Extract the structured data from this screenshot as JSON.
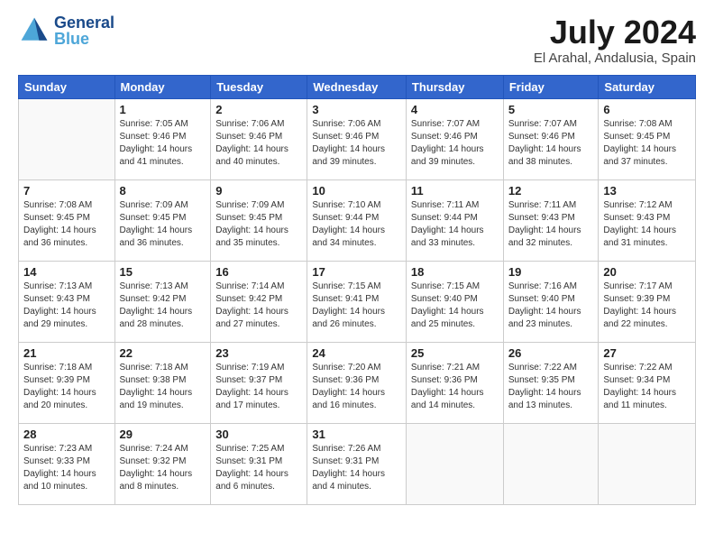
{
  "header": {
    "logo_general": "General",
    "logo_blue": "Blue",
    "month_year": "July 2024",
    "location": "El Arahal, Andalusia, Spain"
  },
  "days_of_week": [
    "Sunday",
    "Monday",
    "Tuesday",
    "Wednesday",
    "Thursday",
    "Friday",
    "Saturday"
  ],
  "weeks": [
    [
      {
        "day": "",
        "sunrise": "",
        "sunset": "",
        "daylight": ""
      },
      {
        "day": "1",
        "sunrise": "Sunrise: 7:05 AM",
        "sunset": "Sunset: 9:46 PM",
        "daylight": "Daylight: 14 hours and 41 minutes."
      },
      {
        "day": "2",
        "sunrise": "Sunrise: 7:06 AM",
        "sunset": "Sunset: 9:46 PM",
        "daylight": "Daylight: 14 hours and 40 minutes."
      },
      {
        "day": "3",
        "sunrise": "Sunrise: 7:06 AM",
        "sunset": "Sunset: 9:46 PM",
        "daylight": "Daylight: 14 hours and 39 minutes."
      },
      {
        "day": "4",
        "sunrise": "Sunrise: 7:07 AM",
        "sunset": "Sunset: 9:46 PM",
        "daylight": "Daylight: 14 hours and 39 minutes."
      },
      {
        "day": "5",
        "sunrise": "Sunrise: 7:07 AM",
        "sunset": "Sunset: 9:46 PM",
        "daylight": "Daylight: 14 hours and 38 minutes."
      },
      {
        "day": "6",
        "sunrise": "Sunrise: 7:08 AM",
        "sunset": "Sunset: 9:45 PM",
        "daylight": "Daylight: 14 hours and 37 minutes."
      }
    ],
    [
      {
        "day": "7",
        "sunrise": "Sunrise: 7:08 AM",
        "sunset": "Sunset: 9:45 PM",
        "daylight": "Daylight: 14 hours and 36 minutes."
      },
      {
        "day": "8",
        "sunrise": "Sunrise: 7:09 AM",
        "sunset": "Sunset: 9:45 PM",
        "daylight": "Daylight: 14 hours and 36 minutes."
      },
      {
        "day": "9",
        "sunrise": "Sunrise: 7:09 AM",
        "sunset": "Sunset: 9:45 PM",
        "daylight": "Daylight: 14 hours and 35 minutes."
      },
      {
        "day": "10",
        "sunrise": "Sunrise: 7:10 AM",
        "sunset": "Sunset: 9:44 PM",
        "daylight": "Daylight: 14 hours and 34 minutes."
      },
      {
        "day": "11",
        "sunrise": "Sunrise: 7:11 AM",
        "sunset": "Sunset: 9:44 PM",
        "daylight": "Daylight: 14 hours and 33 minutes."
      },
      {
        "day": "12",
        "sunrise": "Sunrise: 7:11 AM",
        "sunset": "Sunset: 9:43 PM",
        "daylight": "Daylight: 14 hours and 32 minutes."
      },
      {
        "day": "13",
        "sunrise": "Sunrise: 7:12 AM",
        "sunset": "Sunset: 9:43 PM",
        "daylight": "Daylight: 14 hours and 31 minutes."
      }
    ],
    [
      {
        "day": "14",
        "sunrise": "Sunrise: 7:13 AM",
        "sunset": "Sunset: 9:43 PM",
        "daylight": "Daylight: 14 hours and 29 minutes."
      },
      {
        "day": "15",
        "sunrise": "Sunrise: 7:13 AM",
        "sunset": "Sunset: 9:42 PM",
        "daylight": "Daylight: 14 hours and 28 minutes."
      },
      {
        "day": "16",
        "sunrise": "Sunrise: 7:14 AM",
        "sunset": "Sunset: 9:42 PM",
        "daylight": "Daylight: 14 hours and 27 minutes."
      },
      {
        "day": "17",
        "sunrise": "Sunrise: 7:15 AM",
        "sunset": "Sunset: 9:41 PM",
        "daylight": "Daylight: 14 hours and 26 minutes."
      },
      {
        "day": "18",
        "sunrise": "Sunrise: 7:15 AM",
        "sunset": "Sunset: 9:40 PM",
        "daylight": "Daylight: 14 hours and 25 minutes."
      },
      {
        "day": "19",
        "sunrise": "Sunrise: 7:16 AM",
        "sunset": "Sunset: 9:40 PM",
        "daylight": "Daylight: 14 hours and 23 minutes."
      },
      {
        "day": "20",
        "sunrise": "Sunrise: 7:17 AM",
        "sunset": "Sunset: 9:39 PM",
        "daylight": "Daylight: 14 hours and 22 minutes."
      }
    ],
    [
      {
        "day": "21",
        "sunrise": "Sunrise: 7:18 AM",
        "sunset": "Sunset: 9:39 PM",
        "daylight": "Daylight: 14 hours and 20 minutes."
      },
      {
        "day": "22",
        "sunrise": "Sunrise: 7:18 AM",
        "sunset": "Sunset: 9:38 PM",
        "daylight": "Daylight: 14 hours and 19 minutes."
      },
      {
        "day": "23",
        "sunrise": "Sunrise: 7:19 AM",
        "sunset": "Sunset: 9:37 PM",
        "daylight": "Daylight: 14 hours and 17 minutes."
      },
      {
        "day": "24",
        "sunrise": "Sunrise: 7:20 AM",
        "sunset": "Sunset: 9:36 PM",
        "daylight": "Daylight: 14 hours and 16 minutes."
      },
      {
        "day": "25",
        "sunrise": "Sunrise: 7:21 AM",
        "sunset": "Sunset: 9:36 PM",
        "daylight": "Daylight: 14 hours and 14 minutes."
      },
      {
        "day": "26",
        "sunrise": "Sunrise: 7:22 AM",
        "sunset": "Sunset: 9:35 PM",
        "daylight": "Daylight: 14 hours and 13 minutes."
      },
      {
        "day": "27",
        "sunrise": "Sunrise: 7:22 AM",
        "sunset": "Sunset: 9:34 PM",
        "daylight": "Daylight: 14 hours and 11 minutes."
      }
    ],
    [
      {
        "day": "28",
        "sunrise": "Sunrise: 7:23 AM",
        "sunset": "Sunset: 9:33 PM",
        "daylight": "Daylight: 14 hours and 10 minutes."
      },
      {
        "day": "29",
        "sunrise": "Sunrise: 7:24 AM",
        "sunset": "Sunset: 9:32 PM",
        "daylight": "Daylight: 14 hours and 8 minutes."
      },
      {
        "day": "30",
        "sunrise": "Sunrise: 7:25 AM",
        "sunset": "Sunset: 9:31 PM",
        "daylight": "Daylight: 14 hours and 6 minutes."
      },
      {
        "day": "31",
        "sunrise": "Sunrise: 7:26 AM",
        "sunset": "Sunset: 9:31 PM",
        "daylight": "Daylight: 14 hours and 4 minutes."
      },
      {
        "day": "",
        "sunrise": "",
        "sunset": "",
        "daylight": ""
      },
      {
        "day": "",
        "sunrise": "",
        "sunset": "",
        "daylight": ""
      },
      {
        "day": "",
        "sunrise": "",
        "sunset": "",
        "daylight": ""
      }
    ]
  ]
}
